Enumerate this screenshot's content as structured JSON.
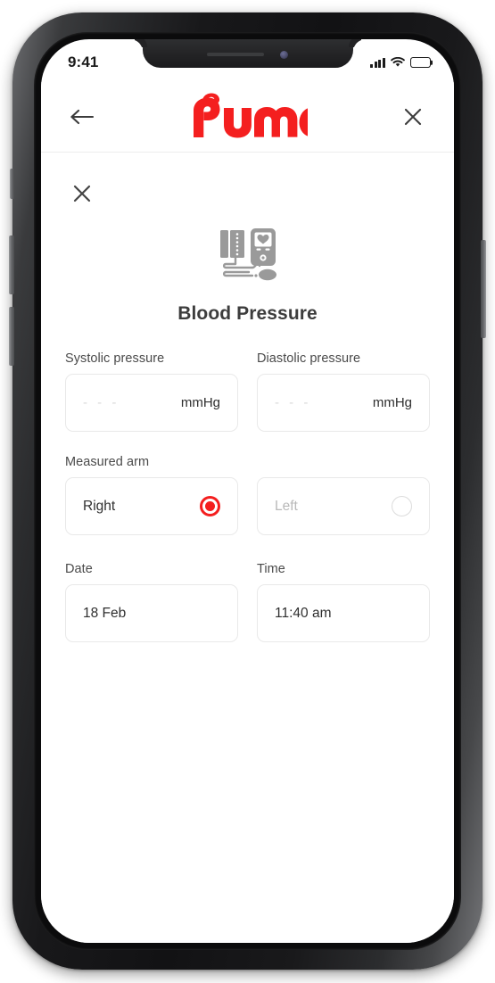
{
  "status_bar": {
    "time": "9:41",
    "signal_icon": "cellular-signal-icon",
    "wifi_icon": "wifi-icon",
    "battery_icon": "battery-full-icon"
  },
  "header": {
    "back_icon": "back-arrow-icon",
    "logo_text": "Pump",
    "close_icon": "close-icon"
  },
  "sheet": {
    "close_icon": "close-icon",
    "illustration_icon": "blood-pressure-monitor-icon",
    "title": "Blood Pressure"
  },
  "fields": {
    "systolic": {
      "label": "Systolic pressure",
      "value": "- - -",
      "unit": "mmHg"
    },
    "diastolic": {
      "label": "Diastolic pressure",
      "value": "- - -",
      "unit": "mmHg"
    },
    "measured_arm": {
      "label": "Measured arm",
      "options": [
        {
          "label": "Right",
          "selected": true
        },
        {
          "label": "Left",
          "selected": false
        }
      ]
    },
    "date": {
      "label": "Date",
      "value": "18 Feb"
    },
    "time": {
      "label": "Time",
      "value": "11:40 am"
    }
  },
  "colors": {
    "brand_red": "#f41f1f",
    "text_primary": "#2f2f2f",
    "text_muted": "#b9b9b9",
    "border": "#e9e9e9"
  }
}
